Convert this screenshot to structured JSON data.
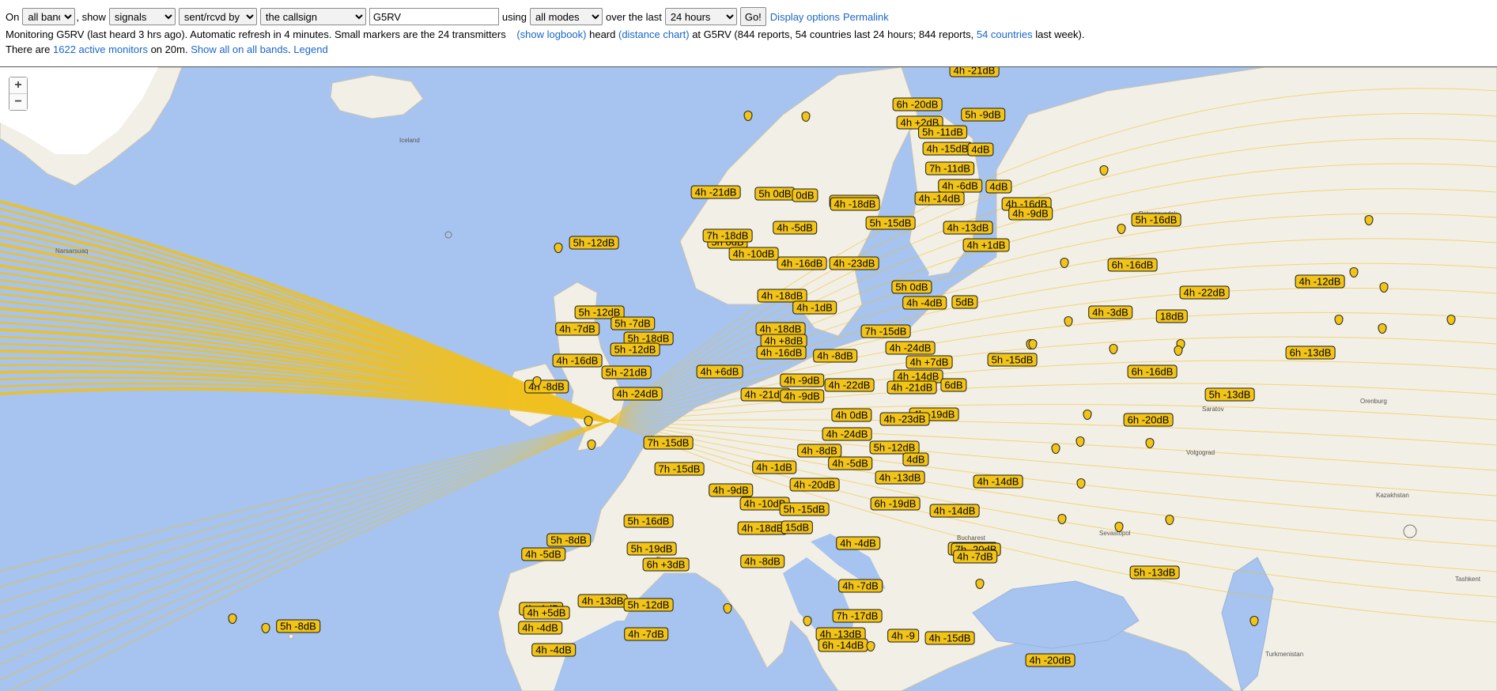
{
  "controls": {
    "on_label": "On",
    "bands": "all bands",
    "show_label": ", show",
    "show": "signals",
    "direction": "sent/rcvd by",
    "target": "the callsign",
    "callsign": "G5RV",
    "using_label": "using",
    "modes": "all modes",
    "over_label": "over the last",
    "period": "24 hours",
    "go": "Go!",
    "display_options": "Display options",
    "permalink": "Permalink"
  },
  "status": {
    "text_a": "Monitoring G5RV (last heard 3 hrs ago). Automatic refresh in 4 minutes. Small markers are the 24 transmitters",
    "show_logbook": "(show logbook)",
    "heard": "heard",
    "distance_chart": "(distance chart)",
    "text_b": "at G5RV (844 reports, 54 countries last 24 hours; 844 reports,",
    "countries_link": "54 countries",
    "text_c": "last week)."
  },
  "monitors": {
    "text_a": "There are",
    "active_link": "1622 active monitors",
    "text_b": "on 20m.",
    "show_all": "Show all on all bands",
    "legend": "Legend"
  },
  "map": {
    "zoom_in": "+",
    "zoom_out": "−",
    "colors": {
      "sea": "#a6c4ef",
      "land": "#f2efe6",
      "marker": "#f2c418",
      "path": "#f0c020"
    },
    "place_names": [
      "Iceland",
      "Narsarsuaq",
      "France",
      "Bucharest",
      "Sevastopol",
      "Turkmenistan",
      "Kazakhstan",
      "Orenburg",
      "Petrozavodsk",
      "Volgograd",
      "Saratov",
      "Tashkent"
    ],
    "report_labels": [
      "4h -21dB",
      "6h -20dB",
      "5h -9dB",
      "4h +2dB",
      "5h -11dB",
      "4h -15dB",
      "4dB",
      "7h -11dB",
      "4h -6dB",
      "4dB",
      "4h -14dB",
      "4h -16dB",
      "4h -18dB",
      "4h -9dB",
      "4h -21dB",
      "5h 0dB",
      "0dB",
      "4h -18dB",
      "5h -16dB",
      "5h -15dB",
      "4h -13dB",
      "4h +1dB",
      "4h -5dB",
      "5h 0dB",
      "7h -18dB",
      "4h -10dB",
      "5h -12dB",
      "4h -16dB",
      "4h -23dB",
      "6h -16dB",
      "5h 0dB",
      "4h -22dB",
      "4h -18dB",
      "4h -4dB",
      "5dB",
      "4h -12dB",
      "4h -1dB",
      "4h -3dB",
      "18dB",
      "5h -12dB",
      "5h -7dB",
      "4h -18dB",
      "7h -15dB",
      "4h -7dB",
      "5h -18dB",
      "4h +8dB",
      "5h -12dB",
      "4h -16dB",
      "4h -24dB",
      "6h -13dB",
      "4h +7dB",
      "4h -8dB",
      "4h -16dB",
      "5h -15dB",
      "4h +6dB",
      "6h -16dB",
      "4h -14dB",
      "4h -8dB",
      "5h -21dB",
      "4h -9dB",
      "4h -22dB",
      "4h -21dB",
      "6dB",
      "4h -24dB",
      "4h -21dB",
      "5h -13dB",
      "4h -9dB",
      "4h -19dB",
      "4h 0dB",
      "4h -23dB",
      "6h -20dB",
      "7h -15dB",
      "4h -24dB",
      "4h -8dB",
      "5h -12dB",
      "7h -15dB",
      "4h -1dB",
      "4h -5dB",
      "4dB",
      "4h -13dB",
      "4h -14dB",
      "4h -9dB",
      "4h -20dB",
      "6h -19dB",
      "4h -10dB",
      "5h -15dB",
      "4h -14dB",
      "5h -16dB",
      "4h -18dB",
      "15dB",
      "5h -8dB",
      "5h -19dB",
      "4h -4dB",
      "5h -18dB",
      "4h -5dB",
      "6h +3dB",
      "7h -20dB",
      "4h -7dB",
      "4h -8dB",
      "4h -7dB",
      "5h -13dB",
      "4h -13dB",
      "4h -1dB",
      "5h -12dB",
      "7h -17dB",
      "4h -4dB",
      "4h -7dB",
      "5h -8dB",
      "4h -13dB",
      "4h -15dB",
      "4h -4dB",
      "6h -14dB",
      "4h -20dB",
      "4h +5dB",
      "4h -9"
    ]
  }
}
